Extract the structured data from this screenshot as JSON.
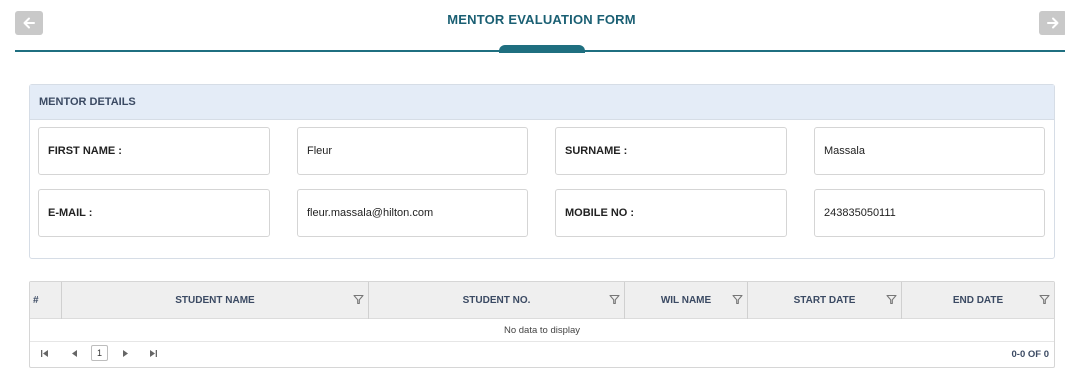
{
  "header": {
    "title": "MENTOR EVALUATION FORM",
    "prev_icon": "arrow-left-icon",
    "next_icon": "arrow-right-icon"
  },
  "mentor_details": {
    "title": "MENTOR DETAILS",
    "first_name_label": "FIRST NAME :",
    "first_name_value": "Fleur",
    "surname_label": "SURNAME :",
    "surname_value": "Massala",
    "email_label": "E-MAIL :",
    "email_value": "fleur.massala@hilton.com",
    "mobile_label": "MOBILE NO :",
    "mobile_value": "243835050111"
  },
  "grid": {
    "columns": [
      "#",
      "STUDENT NAME",
      "STUDENT NO.",
      "WIL NAME",
      "START DATE",
      "END DATE"
    ],
    "filter_icon": "filter-icon",
    "empty_text": "No data to display",
    "current_page": "1",
    "page_info": "0-0 OF 0"
  },
  "colors": {
    "accent": "#1f6f80",
    "title": "#1a5f73",
    "panel_header_bg": "#e4ecf7",
    "nav_button_bg": "#c9c9c9"
  }
}
